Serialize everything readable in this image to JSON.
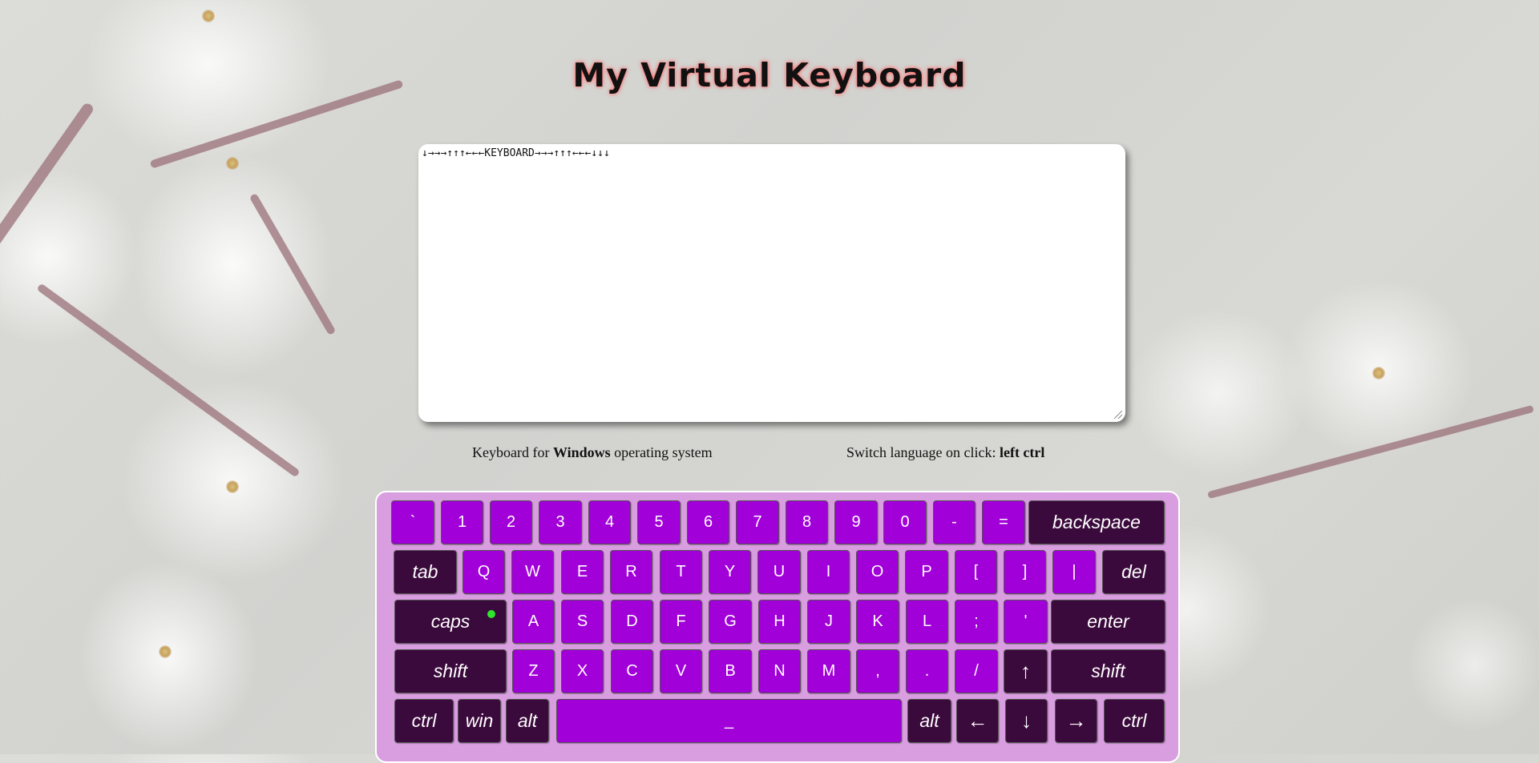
{
  "title": "My Virtual Keyboard",
  "textarea": {
    "value": "↓→→→↑↑↑←←←KEYBOARD→→→↑↑↑←←←↓↓↓"
  },
  "info": {
    "os_prefix": "Keyboard for ",
    "os_name": "Windows",
    "os_suffix": " operating system",
    "lang_prefix": "Switch language on click: ",
    "lang_key": "left ctrl"
  },
  "colors": {
    "key": "#a100d9",
    "key_special": "#3b0a3c",
    "keyboard_bg": "#d99ee0",
    "caps_indicator": "#2ee62e"
  },
  "keyboard": {
    "caps_lock_active": true,
    "rows": [
      [
        {
          "label": "`",
          "name": "key-backtick"
        },
        {
          "label": "1",
          "name": "key-1"
        },
        {
          "label": "2",
          "name": "key-2"
        },
        {
          "label": "3",
          "name": "key-3"
        },
        {
          "label": "4",
          "name": "key-4"
        },
        {
          "label": "5",
          "name": "key-5"
        },
        {
          "label": "6",
          "name": "key-6"
        },
        {
          "label": "7",
          "name": "key-7"
        },
        {
          "label": "8",
          "name": "key-8"
        },
        {
          "label": "9",
          "name": "key-9"
        },
        {
          "label": "0",
          "name": "key-0"
        },
        {
          "label": "-",
          "name": "key-minus"
        },
        {
          "label": "=",
          "name": "key-equals"
        },
        {
          "label": "backspace",
          "name": "key-backspace",
          "special": true
        }
      ],
      [
        {
          "label": "tab",
          "name": "key-tab",
          "special": true
        },
        {
          "label": "Q",
          "name": "key-q"
        },
        {
          "label": "W",
          "name": "key-w"
        },
        {
          "label": "E",
          "name": "key-e"
        },
        {
          "label": "R",
          "name": "key-r"
        },
        {
          "label": "T",
          "name": "key-t"
        },
        {
          "label": "Y",
          "name": "key-y"
        },
        {
          "label": "U",
          "name": "key-u"
        },
        {
          "label": "I",
          "name": "key-i"
        },
        {
          "label": "O",
          "name": "key-o"
        },
        {
          "label": "P",
          "name": "key-p"
        },
        {
          "label": "[",
          "name": "key-left-bracket"
        },
        {
          "label": "]",
          "name": "key-right-bracket"
        },
        {
          "label": "|",
          "name": "key-pipe"
        },
        {
          "label": "del",
          "name": "key-del",
          "special": true
        }
      ],
      [
        {
          "label": "caps",
          "name": "key-caps",
          "special": true,
          "indicator": true
        },
        {
          "label": "A",
          "name": "key-a"
        },
        {
          "label": "S",
          "name": "key-s"
        },
        {
          "label": "D",
          "name": "key-d"
        },
        {
          "label": "F",
          "name": "key-f"
        },
        {
          "label": "G",
          "name": "key-g"
        },
        {
          "label": "H",
          "name": "key-h"
        },
        {
          "label": "J",
          "name": "key-j"
        },
        {
          "label": "K",
          "name": "key-k"
        },
        {
          "label": "L",
          "name": "key-l"
        },
        {
          "label": ";",
          "name": "key-semicolon"
        },
        {
          "label": "'",
          "name": "key-quote"
        },
        {
          "label": "enter",
          "name": "key-enter",
          "special": true
        }
      ],
      [
        {
          "label": "shift",
          "name": "key-shift-left",
          "special": true
        },
        {
          "label": "Z",
          "name": "key-z"
        },
        {
          "label": "X",
          "name": "key-x"
        },
        {
          "label": "C",
          "name": "key-c"
        },
        {
          "label": "V",
          "name": "key-v"
        },
        {
          "label": "B",
          "name": "key-b"
        },
        {
          "label": "N",
          "name": "key-n"
        },
        {
          "label": "M",
          "name": "key-m"
        },
        {
          "label": ",",
          "name": "key-comma"
        },
        {
          "label": ".",
          "name": "key-period"
        },
        {
          "label": "/",
          "name": "key-slash"
        },
        {
          "label": "↑",
          "name": "key-arrow-up",
          "special": true,
          "arrow": true
        },
        {
          "label": "shift",
          "name": "key-shift-right",
          "special": true
        }
      ],
      [
        {
          "label": "ctrl",
          "name": "key-ctrl-left",
          "special": true
        },
        {
          "label": "win",
          "name": "key-win",
          "special": true
        },
        {
          "label": "alt",
          "name": "key-alt-left",
          "special": true
        },
        {
          "label": "_",
          "name": "key-space"
        },
        {
          "label": "alt",
          "name": "key-alt-right",
          "special": true
        },
        {
          "label": "←",
          "name": "key-arrow-left",
          "special": true,
          "arrow": true
        },
        {
          "label": "↓",
          "name": "key-arrow-down",
          "special": true,
          "arrow": true
        },
        {
          "label": "→",
          "name": "key-arrow-right",
          "special": true,
          "arrow": true
        },
        {
          "label": "ctrl",
          "name": "key-ctrl-right",
          "special": true
        }
      ]
    ]
  }
}
